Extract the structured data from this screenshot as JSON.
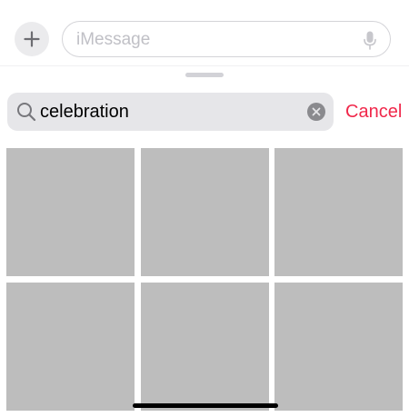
{
  "compose": {
    "plus_icon": "plus-icon",
    "message_placeholder": "iMessage",
    "mic_icon": "microphone-icon"
  },
  "search": {
    "value": "celebration",
    "search_icon": "magnifying-glass-icon",
    "clear_icon": "xmark-circle-icon",
    "cancel_label": "Cancel"
  },
  "results": {
    "tile_count": 6
  },
  "colors": {
    "accent": "#f0284b",
    "tile_placeholder": "#bdbdbd",
    "search_field_bg": "#e6e6e9"
  }
}
